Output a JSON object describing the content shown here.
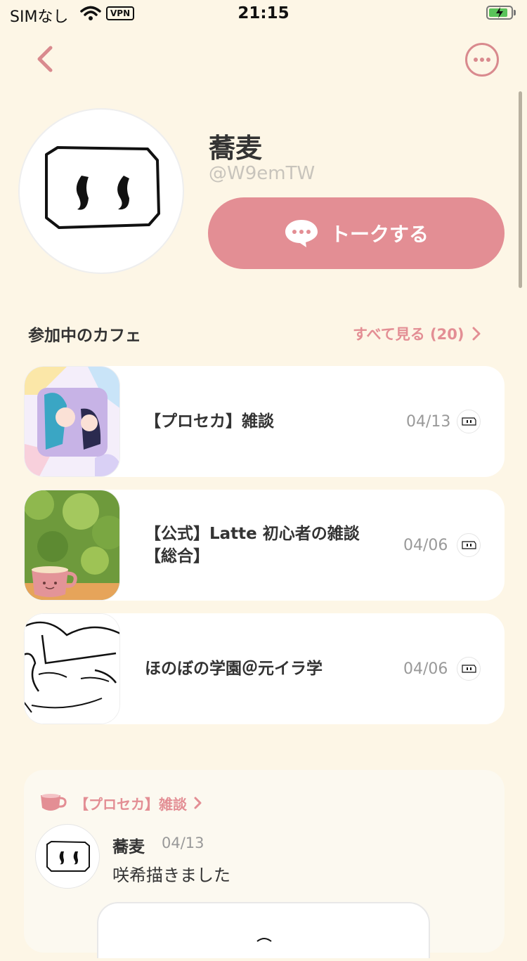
{
  "status_bar": {
    "carrier": "SIMなし",
    "vpn": "VPN",
    "time": "21:15"
  },
  "profile": {
    "name": "蕎麦",
    "handle": "@W9emTW",
    "talk_label": "トークする"
  },
  "cafes_section": {
    "title": "参加中のカフェ",
    "see_all": "すべて見る (20)",
    "items": [
      {
        "title": "【プロセカ】雑談",
        "date": "04/13"
      },
      {
        "title": "【公式】Latte 初心者の雑談【総合】",
        "date": "04/06"
      },
      {
        "title": "ほのぼの学園＠元イラ学",
        "date": "04/06"
      }
    ]
  },
  "post": {
    "cafe": "【プロセカ】雑談",
    "author": "蕎麦",
    "date": "04/13",
    "text": "咲希描きました"
  },
  "colors": {
    "background": "#fdf6e6",
    "accent": "#e38e94"
  }
}
